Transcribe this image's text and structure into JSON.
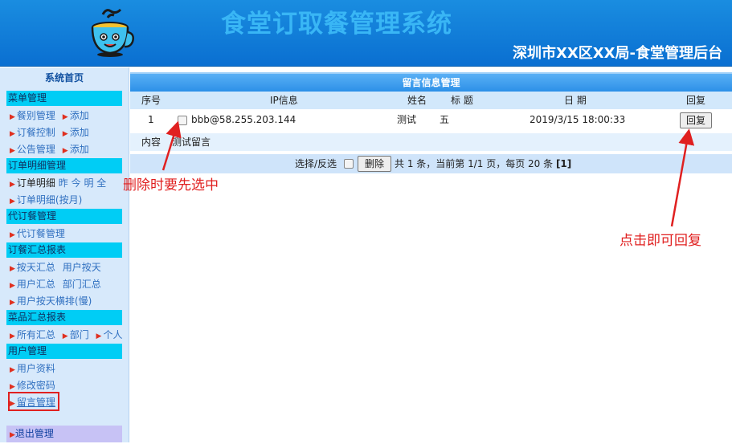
{
  "header": {
    "system_title": "食堂订取餐管理系统",
    "org_title": "深圳市XX区XX局-食堂管理后台"
  },
  "sidebar": {
    "home": "系统首页",
    "groups": {
      "dish": "菜单管理",
      "order_detail": "订单明细管理",
      "proxy": "代订餐管理",
      "summary": "订餐汇总报表",
      "dish_summary": "菜品汇总报表",
      "user": "用户管理"
    },
    "items": {
      "meal_type": "餐别管理",
      "meal_type_add": "添加",
      "order_ctrl": "订餐控制",
      "order_ctrl_add": "添加",
      "notice": "公告管理",
      "notice_add": "添加",
      "order_detail": "订单明细",
      "day_yesterday": "昨",
      "day_today": "今",
      "day_tomorrow": "明",
      "day_all": "全",
      "order_detail_month": "订单明细(按月)",
      "proxy_mgmt": "代订餐管理",
      "sum_by_day": "按天汇总",
      "user_by_day": "用户按天",
      "user_sum": "用户汇总",
      "dept_sum": "部门汇总",
      "user_by_day_h": "用户按天横排(慢)",
      "all_sum": "所有汇总",
      "dept": "部门",
      "person": "个人",
      "user_info": "用户资料",
      "change_pwd": "修改密码",
      "message_mgmt": "留言管理"
    },
    "logout": "退出管理"
  },
  "main": {
    "title": "留言信息管理",
    "columns": {
      "index": "序号",
      "ip": "IP信息",
      "name": "姓名",
      "subject": "标 题",
      "date": "日 期",
      "reply": "回复"
    },
    "row": {
      "index": "1",
      "ip": "bbb@58.255.203.144",
      "name": "测试",
      "subject": "五",
      "date": "2019/3/15 18:00:33",
      "reply_button": "回复"
    },
    "content": {
      "label": "内容",
      "value": "测试留言"
    },
    "footer": {
      "select_label": "选择/反选",
      "delete_button": "删除",
      "pagination": "共 1 条，当前第 1/1 页，每页 20 条",
      "pagination_suffix": "[1]"
    }
  },
  "annotations": {
    "delete_hint": "删除时要先选中",
    "reply_hint": "点击即可回复"
  },
  "colors": {
    "header_blue": "#0a6fd1",
    "title_cyan": "#39b6f5",
    "group_cyan": "#00cdf5",
    "annotation_red": "#e02020"
  }
}
